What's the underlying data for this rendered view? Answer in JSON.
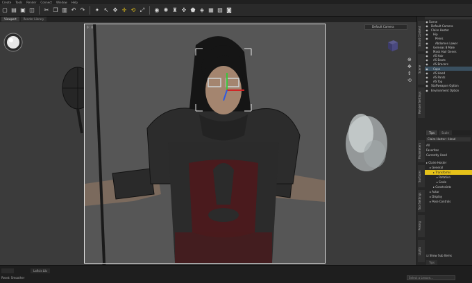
{
  "menu": [
    "Create",
    "Tools",
    "Render",
    "Connect",
    "Window",
    "Help"
  ],
  "toolbar_icons": [
    "new-file-icon",
    "open-icon",
    "save-icon",
    "render-icon",
    "cut-icon",
    "copy-icon",
    "paste-icon",
    "undo-icon",
    "redo-icon",
    "align-icon",
    "node-select-icon",
    "universal-tool-icon",
    "translate-icon",
    "rotate-icon",
    "scale-icon",
    "camera-icon",
    "light-icon",
    "figure-icon",
    "pose-icon",
    "morph-icon",
    "surface-icon",
    "spot-render-icon",
    "aux-view-icon",
    "photo-icon"
  ],
  "viewport_tabs": [
    "Viewport",
    "Render Library"
  ],
  "viewport": {
    "frame_label": "0 : 0",
    "camera_select": "Default Camera"
  },
  "right_strip_top": [
    "Smart Content",
    "Scene",
    "Render Settings"
  ],
  "right_strip_bottom": [
    "Parameters",
    "Surfaces",
    "Tool Settings",
    "Posing",
    "Lights"
  ],
  "scene": {
    "rows": [
      {
        "label": "Scene",
        "indent": 0
      },
      {
        "label": "Default Camera",
        "indent": 1
      },
      {
        "label": "Claire Hoster",
        "indent": 1
      },
      {
        "label": "Hip",
        "indent": 2
      },
      {
        "label": "Pelvis",
        "indent": 3
      },
      {
        "label": "Abdomen Lower",
        "indent": 3
      },
      {
        "label": "Gemeas 8 Male",
        "indent": 2
      },
      {
        "label": "Mask Hair Gener.",
        "indent": 2
      },
      {
        "label": "AS Hair",
        "indent": 2
      },
      {
        "label": "AS Boots",
        "indent": 2
      },
      {
        "label": "AS Bracers",
        "indent": 2
      },
      {
        "label": "Cape",
        "indent": 2,
        "selected": true
      },
      {
        "label": "AS Hood",
        "indent": 2
      },
      {
        "label": "AS Pants",
        "indent": 2
      },
      {
        "label": "AS Top",
        "indent": 2
      },
      {
        "label": "Staffweapon Option",
        "indent": 1
      },
      {
        "label": "Environment Option",
        "indent": 1
      }
    ]
  },
  "lower_tabs": [
    "Tips",
    "Scale"
  ],
  "params": {
    "dropdown": "Claire Hoster : Head",
    "filters": [
      "All",
      "Favorites",
      "Currently Used"
    ],
    "search_placeholder": "",
    "tree": [
      {
        "label": "Claire Hoster",
        "indent": 0
      },
      {
        "label": "General",
        "indent": 1
      },
      {
        "label": "Transforms",
        "indent": 2,
        "highlight": true
      },
      {
        "label": "Rotation",
        "indent": 3
      },
      {
        "label": "Scale",
        "indent": 3
      },
      {
        "label": "Constraints",
        "indent": 2
      },
      {
        "label": "Actor",
        "indent": 1
      },
      {
        "label": "Display",
        "indent": 1
      },
      {
        "label": "Pose Controls",
        "indent": 1
      }
    ],
    "show_sub_items": "Show Sub Items",
    "bottom_tab": "Tips"
  },
  "status": {
    "tabs": [
      "",
      "Laficis Lib"
    ],
    "hint": "Reset: Smoother",
    "lesson_placeholder": "Select a Lesson..."
  }
}
